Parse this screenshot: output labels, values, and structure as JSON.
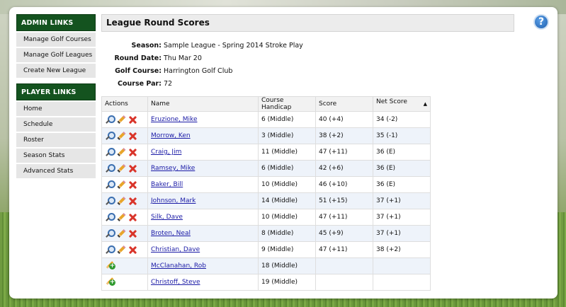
{
  "sidebar": {
    "admin_header": "ADMIN LINKS",
    "admin_items": [
      {
        "label": "Manage Golf Courses"
      },
      {
        "label": "Manage Golf Leagues"
      },
      {
        "label": "Create New League"
      }
    ],
    "player_header": "PLAYER LINKS",
    "player_items": [
      {
        "label": "Home"
      },
      {
        "label": "Schedule"
      },
      {
        "label": "Roster"
      },
      {
        "label": "Season Stats"
      },
      {
        "label": "Advanced Stats"
      }
    ]
  },
  "page": {
    "title": "League Round Scores",
    "help_glyph": "?"
  },
  "info": {
    "season_label": "Season:",
    "season_value": "Sample League - Spring 2014 Stroke Play",
    "round_date_label": "Round Date:",
    "round_date_value": "Thu Mar 20",
    "course_label": "Golf Course:",
    "course_value": "Harrington Golf Club",
    "par_label": "Course Par:",
    "par_value": "72"
  },
  "table": {
    "headers": {
      "actions": "Actions",
      "name": "Name",
      "handicap": "Course Handicap",
      "score": "Score",
      "net": "Net Score",
      "sort_indicator": "▲"
    },
    "rows": [
      {
        "name": "Eruzione, Mike",
        "handicap": "6 (Middle)",
        "score": "40 (+4)",
        "net": "34 (-2)"
      },
      {
        "name": "Morrow, Ken",
        "handicap": "3 (Middle)",
        "score": "38 (+2)",
        "net": "35 (-1)"
      },
      {
        "name": "Craig, Jim",
        "handicap": "11 (Middle)",
        "score": "47 (+11)",
        "net": "36 (E)"
      },
      {
        "name": "Ramsey, Mike",
        "handicap": "6 (Middle)",
        "score": "42 (+6)",
        "net": "36 (E)"
      },
      {
        "name": "Baker, Bill",
        "handicap": "10 (Middle)",
        "score": "46 (+10)",
        "net": "36 (E)"
      },
      {
        "name": "Johnson, Mark",
        "handicap": "14 (Middle)",
        "score": "51 (+15)",
        "net": "37 (+1)"
      },
      {
        "name": "Silk, Dave",
        "handicap": "10 (Middle)",
        "score": "47 (+11)",
        "net": "37 (+1)"
      },
      {
        "name": "Broten, Neal",
        "handicap": "8 (Middle)",
        "score": "45 (+9)",
        "net": "37 (+1)"
      },
      {
        "name": "Christian, Dave",
        "handicap": "9 (Middle)",
        "score": "47 (+11)",
        "net": "38 (+2)"
      },
      {
        "name": "McClanahan, Rob",
        "handicap": "18 (Middle)",
        "score": "",
        "net": ""
      },
      {
        "name": "Christoff, Steve",
        "handicap": "19 (Middle)",
        "score": "",
        "net": ""
      }
    ]
  },
  "icons": {
    "view": "magnifier-icon",
    "edit": "pencil-icon",
    "delete": "delete-x-icon",
    "add_score": "add-score-icon"
  },
  "colors": {
    "sidebar_header": "#14531f",
    "link": "#1a1aa6",
    "alt_row": "#eef3fa"
  }
}
